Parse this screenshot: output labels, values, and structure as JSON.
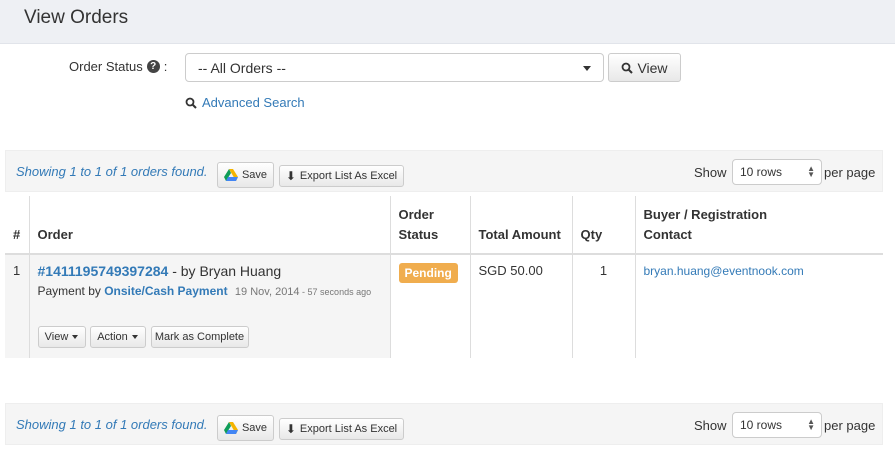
{
  "header": {
    "title": "View Orders"
  },
  "filter": {
    "status_label": "Order Status",
    "help_glyph": "?",
    "status_value": "-- All Orders --",
    "view_label": "View",
    "advanced_search_label": "Advanced Search"
  },
  "list_bar": {
    "found_text": "Showing 1 to 1 of 1 orders found.",
    "save_label": "Save",
    "export_label": "Export List As Excel",
    "show_label": "Show",
    "rows_value": "10 rows",
    "per_page_label": "per page"
  },
  "table": {
    "columns": {
      "idx": "#",
      "order": "Order",
      "status_line1": "Order",
      "status_line2": "Status",
      "total": "Total Amount",
      "qty": "Qty",
      "buyer_line1": "Buyer / Registration",
      "buyer_line2": "Contact"
    },
    "rows": [
      {
        "index": "1",
        "order_id": "#1411195749397284",
        "by": " - by Bryan Huang",
        "payment_prefix": "Payment by ",
        "payment_method": "Onsite/Cash Payment",
        "date": "19 Nov, 2014",
        "ago": " - 57 seconds ago",
        "status": "Pending",
        "total": "SGD 50.00",
        "qty": "1",
        "email": "bryan.huang@eventnook.com",
        "actions": {
          "view": "View",
          "action": "Action",
          "complete": "Mark as Complete"
        }
      }
    ]
  },
  "colors": {
    "accent": "#337ab7",
    "pending": "#f0ad4e",
    "header_bg": "#eef0f4"
  }
}
